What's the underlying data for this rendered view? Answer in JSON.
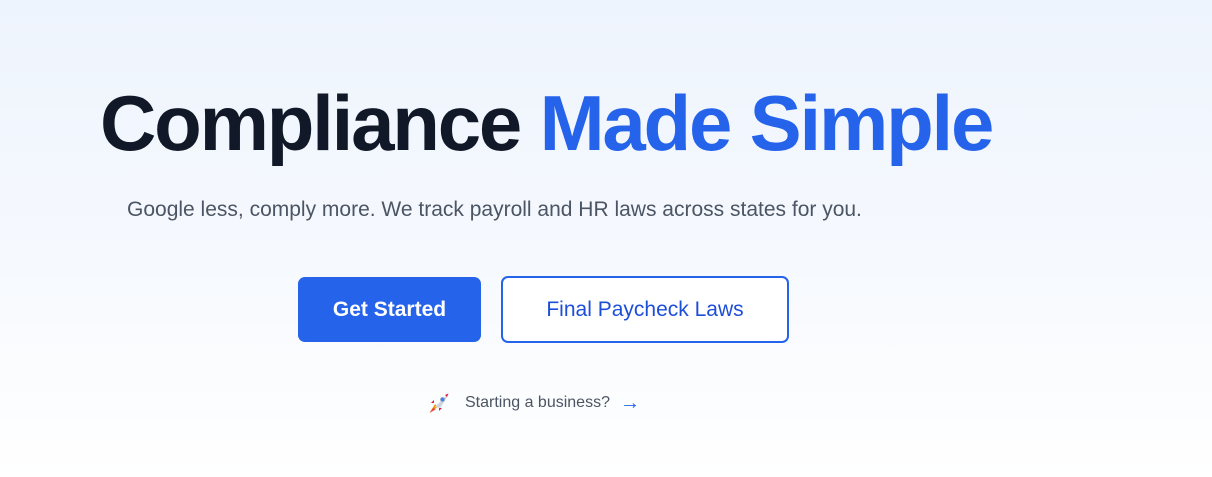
{
  "hero": {
    "title_part1": "Compliance",
    "title_part2": "Made Simple",
    "subtitle": "Google less, comply more. We track payroll and HR laws across states for you."
  },
  "cta": {
    "primary_label": "Get Started",
    "secondary_label": "Final Paycheck Laws"
  },
  "business_link": {
    "icon": "rocket-icon",
    "label": "Starting a business?",
    "arrow": "→"
  },
  "colors": {
    "accent": "#2563eb",
    "heading": "#111827",
    "body_text": "#4b5563"
  }
}
